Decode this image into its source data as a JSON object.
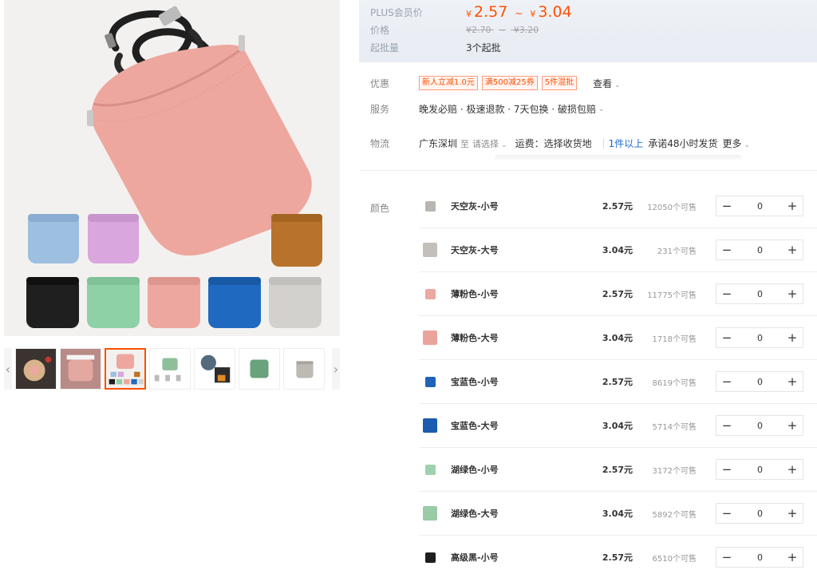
{
  "gallery": {
    "prev_icon": "chevron-left-icon",
    "next_icon": "chevron-right-icon",
    "thumbnails": [
      {
        "name": "thumb-1",
        "active": false
      },
      {
        "name": "thumb-2",
        "active": false
      },
      {
        "name": "thumb-3",
        "active": true
      },
      {
        "name": "thumb-4",
        "active": false
      },
      {
        "name": "thumb-5",
        "active": false
      },
      {
        "name": "thumb-6",
        "active": false
      },
      {
        "name": "thumb-7",
        "active": false
      }
    ]
  },
  "price": {
    "plus_label": "PLUS会员价",
    "currency": "¥",
    "plus_low": "2.57",
    "plus_high": "3.04",
    "tilde": "~",
    "price_label": "价格",
    "orig_low": "¥2.70",
    "orig_high": "¥3.20",
    "minorder_label": "起批量",
    "minorder_value": "3个起批"
  },
  "promo": {
    "label": "优惠",
    "tags": [
      "新人立减1.0元",
      "满500减25券",
      "5件混批"
    ],
    "more": "查看"
  },
  "service": {
    "label": "服务",
    "text": "晚发必赔 · 极速退款 · 7天包换 · 破损包赔"
  },
  "logistics": {
    "label": "物流",
    "origin": "广东深圳",
    "to": "至",
    "select": "请选择",
    "fee": "运费：选择收货地",
    "qty": "1件以上",
    "promise": "承诺48小时发货",
    "more": "更多"
  },
  "sku": {
    "label": "颜色",
    "items": [
      {
        "name": "天空灰-小号",
        "price": "2.57元",
        "stock": "12050个可售",
        "qty": "0",
        "color": "#b9b6b2",
        "size": "small"
      },
      {
        "name": "天空灰-大号",
        "price": "3.04元",
        "stock": "231个可售",
        "qty": "0",
        "color": "#c3c0bc",
        "size": "large"
      },
      {
        "name": "薄粉色-小号",
        "price": "2.57元",
        "stock": "11775个可售",
        "qty": "0",
        "color": "#eca8a2",
        "size": "small"
      },
      {
        "name": "薄粉色-大号",
        "price": "3.04元",
        "stock": "1718个可售",
        "qty": "0",
        "color": "#eaa49c",
        "size": "large"
      },
      {
        "name": "宝蓝色-小号",
        "price": "2.57元",
        "stock": "8619个可售",
        "qty": "0",
        "color": "#1f63b8",
        "size": "small"
      },
      {
        "name": "宝蓝色-大号",
        "price": "3.04元",
        "stock": "5714个可售",
        "qty": "0",
        "color": "#1a5cb0",
        "size": "large"
      },
      {
        "name": "湖绿色-小号",
        "price": "2.57元",
        "stock": "3172个可售",
        "qty": "0",
        "color": "#9fd1ad",
        "size": "small"
      },
      {
        "name": "湖绿色-大号",
        "price": "3.04元",
        "stock": "5892个可售",
        "qty": "0",
        "color": "#98cba6",
        "size": "large"
      },
      {
        "name": "高级黑-小号",
        "price": "2.57元",
        "stock": "6510个可售",
        "qty": "0",
        "color": "#1e1e1e",
        "size": "small"
      }
    ],
    "minus_icon": "minus-icon",
    "plus_icon": "plus-icon"
  },
  "colors": {
    "accent": "#ff5000",
    "link": "#1a6ad2",
    "pouch_pink": "#eda79f",
    "pouch_blue": "#9dbfe0",
    "pouch_purple": "#d9a6dd",
    "pouch_brown": "#b7732b",
    "pouch_black": "#1f1f1f",
    "pouch_green": "#8fd1a7",
    "pouch_royal": "#1f6ac0",
    "pouch_grey": "#d3d1cd"
  }
}
